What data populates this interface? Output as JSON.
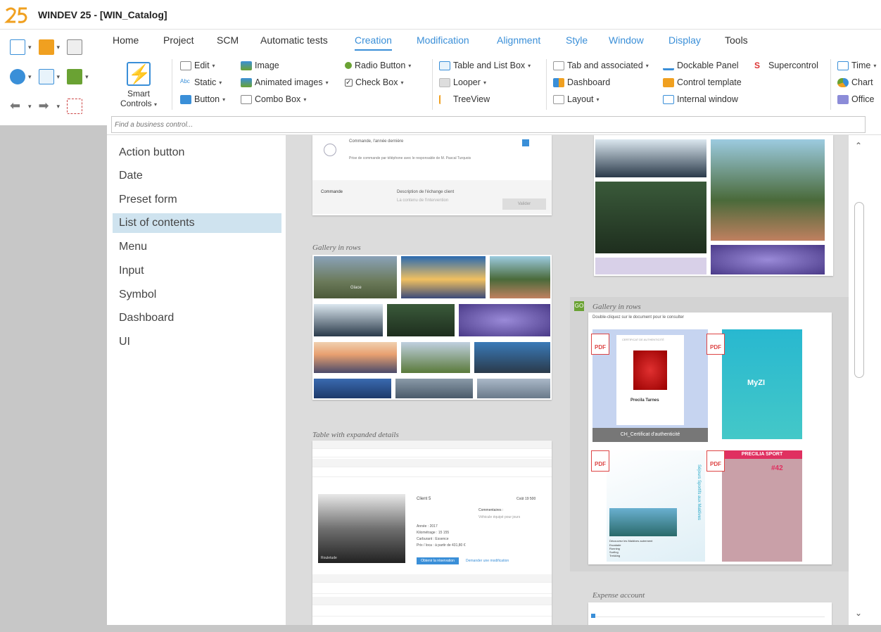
{
  "window": {
    "title": "WINDEV 25 - [WIN_Catalog]"
  },
  "menu": [
    "Home",
    "Project",
    "SCM",
    "Automatic tests",
    "Creation",
    "Modification",
    "Alignment",
    "Style",
    "Window",
    "Display",
    "Tools"
  ],
  "ribbon": {
    "smart_controls": "Smart Controls",
    "col1": [
      "Edit",
      "Static",
      "Button"
    ],
    "col2": [
      "Image",
      "Animated images",
      "Combo Box"
    ],
    "col3": [
      "Radio Button",
      "Check Box"
    ],
    "col4": [
      "Table and List Box",
      "Looper",
      "TreeView"
    ],
    "col5": [
      "Tab and associated",
      "Dashboard",
      "Layout"
    ],
    "col6": [
      "Dockable Panel",
      "Control template",
      "Internal window"
    ],
    "col7": [
      "Supercontrol"
    ],
    "col8": [
      "Time",
      "Chart",
      "Office"
    ]
  },
  "search": {
    "placeholder": "Find a business control..."
  },
  "nav": [
    "Action button",
    "Date",
    "Preset form",
    "List of contents",
    "Menu",
    "Input",
    "Symbol",
    "Dashboard",
    "UI"
  ],
  "nav_selected": "List of contents",
  "cards": {
    "top_card": {
      "title": "Commande, l'année dernière",
      "body": "Prise de commande par téléphone avec le responsable de M. Pascal Turquois",
      "select": "Commande",
      "desc_label": "Description de l'échange client",
      "desc_placeholder": "La contenu de l'intervention",
      "button": "Valider"
    },
    "gallery_rows_1": "Gallery in rows",
    "gallery_rows_1_label": "Glace",
    "table_expanded": "Table with expanded details",
    "table_detail": {
      "title": "Client 5",
      "price": "Coût 19 500",
      "comment_label": "Commentaires :",
      "comment": "Véhicule équipé pour jours",
      "lines": [
        "Année : 2017",
        "Kilométrage : 15 155",
        "Carburant : Essence",
        "Prix / loca : à partir de 431,80 €"
      ],
      "button": "Obtenir la réservation",
      "link": "Demander une modification",
      "image_label": "Rouletude"
    },
    "gallery_rows_2": "Gallery in rows",
    "gallery_rows_2_sub": "Double-cliquez sur le document pour le consulter",
    "doc1_caption": "CH_Certificat d'authenticité",
    "doc1_name": "Precila Tarnes",
    "doc1_cert": "CERTIFICAT DE AUTHENTICITÉ",
    "doc2_title": "MyZI",
    "doc3_title": "Séjours Sportifs aux Maldives",
    "doc3_sub": "Découvrez les Maldives autrement",
    "doc3_list": [
      "Escalade",
      "Running",
      "Surfing",
      "Trekking"
    ],
    "doc4_title": "PRECILIA SPORT",
    "doc4_num": "#42",
    "expense": "Expense account"
  },
  "pdf_label": "PDF",
  "colors": {
    "accent": "#3a8fd8",
    "selected": "#cfe3ef",
    "logo": "#f0a020"
  }
}
